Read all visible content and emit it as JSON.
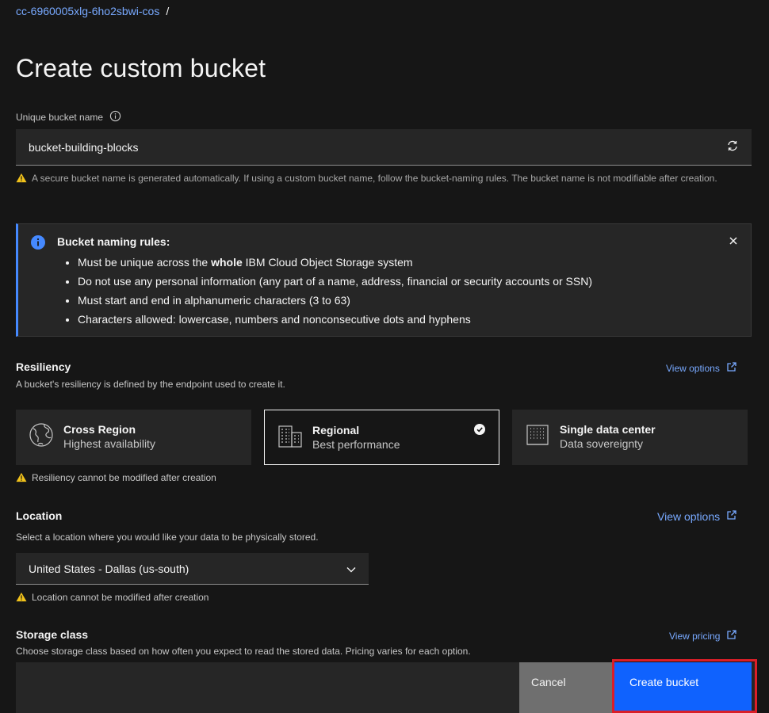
{
  "breadcrumb": {
    "item": "cc-6960005xlg-6ho2sbwi-cos",
    "separator": "/"
  },
  "page": {
    "title": "Create custom bucket"
  },
  "bucket_name": {
    "label": "Unique bucket name",
    "value": "bucket-building-blocks",
    "helper": "A secure bucket name is generated automatically. If using a custom bucket name, follow the bucket-naming rules. The bucket name is not modifiable after creation."
  },
  "naming_rules": {
    "title": "Bucket naming rules:",
    "rule1_pre": "Must be unique across the ",
    "rule1_bold": "whole",
    "rule1_post": " IBM Cloud Object Storage system",
    "rule2": "Do not use any personal information (any part of a name, address, financial or security accounts or SSN)",
    "rule3": "Must start and end in alphanumeric characters (3 to 63)",
    "rule4": "Characters allowed: lowercase, numbers and nonconsecutive dots and hyphens"
  },
  "resiliency": {
    "title": "Resiliency",
    "description": "A bucket's resiliency is defined by the endpoint used to create it.",
    "link": "View options",
    "tiles": [
      {
        "title": "Cross Region",
        "subtitle": "Highest availability",
        "icon": "globe-icon"
      },
      {
        "title": "Regional",
        "subtitle": "Best performance",
        "icon": "buildings-icon",
        "selected": true
      },
      {
        "title": "Single data center",
        "subtitle": "Data sovereignty",
        "icon": "data-center-icon"
      }
    ],
    "warning": "Resiliency cannot be modified after creation"
  },
  "location": {
    "title": "Location",
    "description": "Select a location where you would like your data to be physically stored.",
    "link": "View options",
    "selected": "United States - Dallas (us-south)",
    "warning": "Location cannot be modified after creation"
  },
  "storage_class": {
    "title": "Storage class",
    "description": "Choose storage class based on how often you expect to read the stored data. Pricing varies for each option.",
    "link": "View pricing"
  },
  "actions": {
    "cancel": "Cancel",
    "create": "Create bucket"
  },
  "colors": {
    "background": "#161616",
    "field": "#262626",
    "link": "#78a9ff",
    "primary": "#0f62fe",
    "warning": "#f1c21b",
    "info": "#4589ff",
    "highlight": "#da1e28"
  }
}
